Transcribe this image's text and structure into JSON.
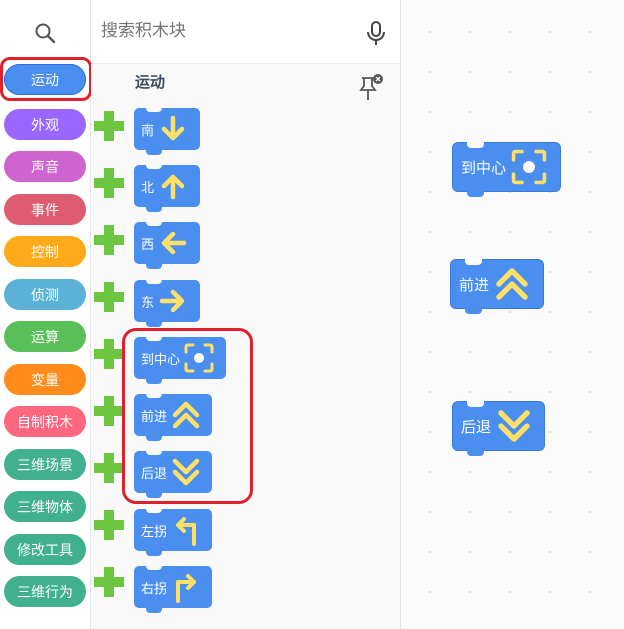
{
  "search": {
    "placeholder": "搜索积木块"
  },
  "categories": [
    {
      "label": "运动",
      "color": "#4a8ff0",
      "selected": true
    },
    {
      "label": "外观",
      "color": "#9966ff"
    },
    {
      "label": "声音",
      "color": "#cf63cf"
    },
    {
      "label": "事件",
      "color": "#de5c6f"
    },
    {
      "label": "控制",
      "color": "#ffab19"
    },
    {
      "label": "侦测",
      "color": "#5cb1d6"
    },
    {
      "label": "运算",
      "color": "#59c059"
    },
    {
      "label": "变量",
      "color": "#ff8c1a"
    },
    {
      "label": "自制积木",
      "color": "#ff6680"
    },
    {
      "label": "三维场景",
      "color": "#40b08f"
    },
    {
      "label": "三维物体",
      "color": "#40b08f"
    },
    {
      "label": "修改工具",
      "color": "#40b08f"
    },
    {
      "label": "三维行为",
      "color": "#40b08f"
    }
  ],
  "flyout": {
    "section_title": "运动",
    "blocks": [
      {
        "label": "南",
        "icon": "arrow-down-icon"
      },
      {
        "label": "北",
        "icon": "arrow-up-icon"
      },
      {
        "label": "西",
        "icon": "arrow-left-icon"
      },
      {
        "label": "东",
        "icon": "arrow-right-icon"
      },
      {
        "label": "到中心",
        "icon": "center-target-icon"
      },
      {
        "label": "前进",
        "icon": "double-chevron-up-icon"
      },
      {
        "label": "后退",
        "icon": "double-chevron-down-icon"
      },
      {
        "label": "左拐",
        "icon": "turn-left-icon"
      },
      {
        "label": "右拐",
        "icon": "turn-right-icon"
      }
    ]
  },
  "workspace": {
    "blocks": [
      {
        "label": "到中心",
        "icon": "center-target-icon"
      },
      {
        "label": "前进",
        "icon": "double-chevron-up-icon"
      },
      {
        "label": "后退",
        "icon": "double-chevron-down-icon"
      }
    ]
  },
  "colors": {
    "block_blue": "#4a8ff0",
    "icon_yellow": "#ffe066",
    "plus_green": "#6cc63f",
    "highlight_red": "#e0202a"
  }
}
